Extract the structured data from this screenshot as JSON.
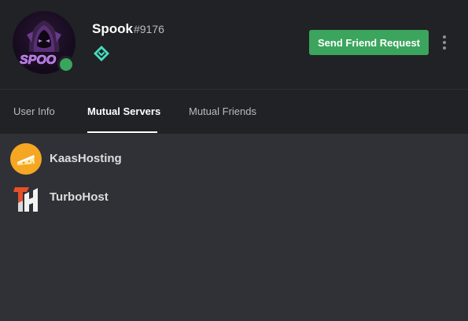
{
  "profile": {
    "username": "Spook",
    "discriminator": "#9176",
    "avatar_text": "SPOO",
    "status": "online",
    "badge_icon": "hypesquad-balance-icon"
  },
  "actions": {
    "send_friend_request_label": "Send Friend Request",
    "more_icon": "more-vertical-icon"
  },
  "tabs": [
    {
      "label": "User Info",
      "active": false
    },
    {
      "label": "Mutual Servers",
      "active": true
    },
    {
      "label": "Mutual Friends",
      "active": false
    }
  ],
  "mutual_servers": [
    {
      "name": "KaasHosting",
      "icon": "cheese-icon"
    },
    {
      "name": "TurboHost",
      "icon": "turbohost-logo-icon"
    }
  ],
  "colors": {
    "header_bg": "#202225",
    "body_bg": "#2f3136",
    "button_green": "#3ba55d",
    "badge_teal": "#45ddc0",
    "kaas_orange": "#f5a623",
    "turbo_red": "#e8502a"
  }
}
